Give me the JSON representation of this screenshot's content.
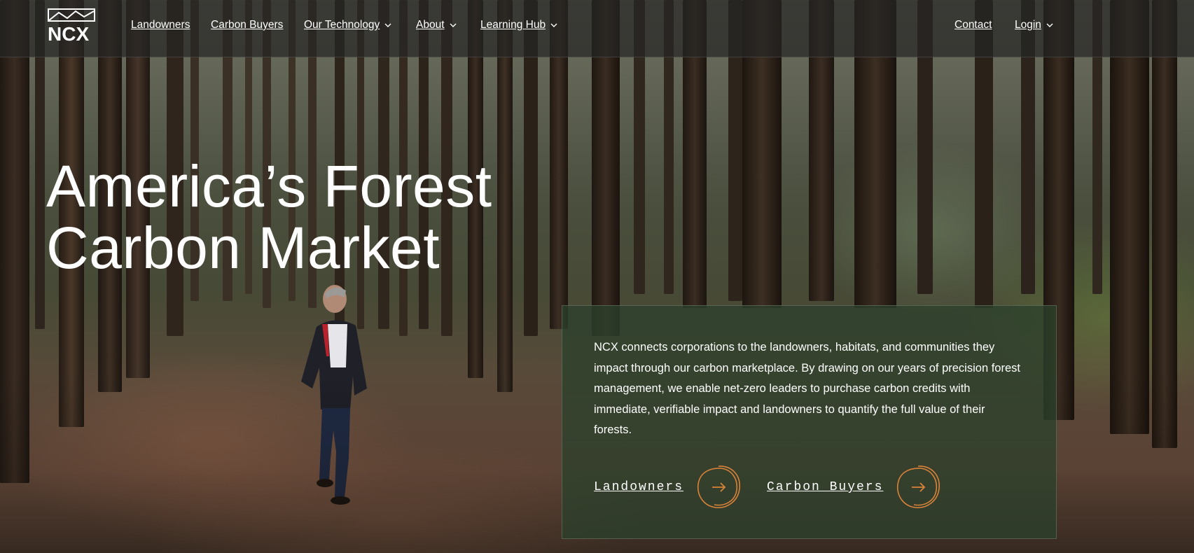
{
  "colors": {
    "accent": "#d9823a",
    "header_bg": "#262624",
    "card_bg": "#2c402c"
  },
  "brand": {
    "logo_text": "NCX"
  },
  "nav": {
    "items": [
      {
        "label": "Landowners",
        "has_dropdown": false
      },
      {
        "label": "Carbon Buyers",
        "has_dropdown": false
      },
      {
        "label": "Our Technology",
        "has_dropdown": true
      },
      {
        "label": "About",
        "has_dropdown": true
      },
      {
        "label": "Learning Hub",
        "has_dropdown": true
      }
    ],
    "right": [
      {
        "label": "Contact",
        "has_dropdown": false
      },
      {
        "label": "Login",
        "has_dropdown": true
      }
    ]
  },
  "hero": {
    "title_line1": "America’s Forest",
    "title_line2": "Carbon Market"
  },
  "card": {
    "description": "NCX connects corporations to the landowners, habitats, and communities they impact through our carbon marketplace. By drawing on our years of precision forest management, we enable net-zero leaders to purchase carbon credits with immediate, verifiable impact and landowners to quantify the full value of their forests.",
    "cta_primary": "Landowners",
    "cta_secondary": "Carbon Buyers",
    "cta_icon": "arrow-right-icon"
  }
}
